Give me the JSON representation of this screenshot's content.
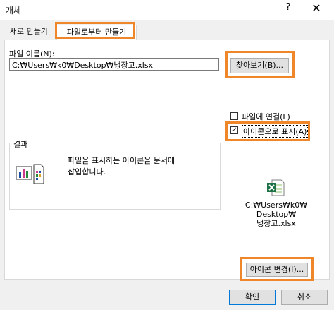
{
  "window": {
    "title": "개체",
    "help_glyph": "?",
    "close_glyph": "✕"
  },
  "tabs": [
    {
      "label": "새로 만들기",
      "active": false
    },
    {
      "label": "파일로부터 만들기",
      "active": true
    }
  ],
  "file": {
    "label": "파일 이름(N):",
    "value": "C:₩Users₩k0₩Desktop₩냉장고.xlsx",
    "browse_label": "찾아보기(B)..."
  },
  "options": {
    "link_label": "파일에 연결(L)",
    "link_checked": false,
    "display_icon_label": "아이콘으로 표시(A)",
    "display_icon_checked": true,
    "check_glyph": "✓"
  },
  "result": {
    "legend": "결과",
    "line1": "파일을 표시하는 아이콘을 문서에",
    "line2": "삽입합니다."
  },
  "icon_preview": {
    "caption_lines": [
      "C:₩Users₩k0₩",
      "Desktop₩",
      "냉장고.xlsx"
    ],
    "change_icon_label": "아이콘 변경(I)..."
  },
  "footer": {
    "ok_label": "확인",
    "cancel_label": "취소"
  },
  "colors": {
    "highlight": "#f0862a",
    "excel_green": "#1e7145",
    "focus_border": "#0078d7"
  }
}
